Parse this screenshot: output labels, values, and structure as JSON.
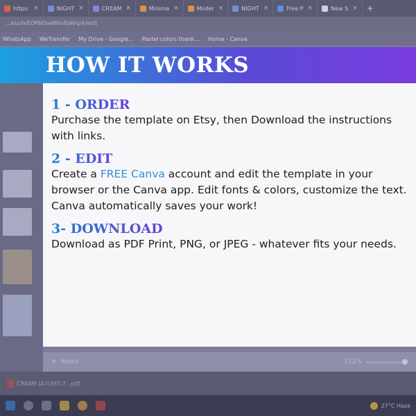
{
  "browser": {
    "tabs": [
      {
        "label": "https:",
        "color": "#e35d4b"
      },
      {
        "label": "NIGHT",
        "color": "#7c8ad8"
      },
      {
        "label": "CREAM",
        "color": "#7c8ad8"
      },
      {
        "label": "Minima",
        "color": "#d9914b"
      },
      {
        "label": "Moder",
        "color": "#d9914b"
      },
      {
        "label": "NIGHT",
        "color": "#7c8ad8"
      },
      {
        "label": "Free P",
        "color": "#5b8fd8"
      },
      {
        "label": "New S",
        "color": "#cfcfe0"
      }
    ],
    "url": "...ess/IvEOP6Doe8Hx8jAVq/4/edit",
    "bookmarks": [
      "WhatsApp",
      "WeTransfer",
      "My Drive - Google...",
      "Pastel colors thank...",
      "Home - Canva"
    ]
  },
  "editor": {
    "notes_label": "Notes",
    "zoom": "122%"
  },
  "downloads": {
    "file": "CREAM (A7/3X5.7...pdf"
  },
  "taskbar": {
    "weather": "27°C  Haze"
  },
  "overlay": {
    "title": "HOW IT WORKS",
    "steps": [
      {
        "title": "1 - ORDER",
        "body": "Purchase the template on Etsy, then Download the instructions with links."
      },
      {
        "title": "2 - EDIT",
        "body_pre": "Create a ",
        "body_link": "FREE Canva",
        "body_post": " account and edit the template in your browser or the Canva app. Edit fonts & colors, customize the text. Canva automatically saves your work!"
      },
      {
        "title": "3- DOWNLOAD",
        "body": "Download as PDF Print, PNG, or JPEG - whatever fits your needs."
      }
    ]
  },
  "colors": {
    "banner_start": "#1ba0e0",
    "banner_end": "#7a3ce0",
    "step_title": "#4a5ad6",
    "link": "#2f8fd8"
  }
}
